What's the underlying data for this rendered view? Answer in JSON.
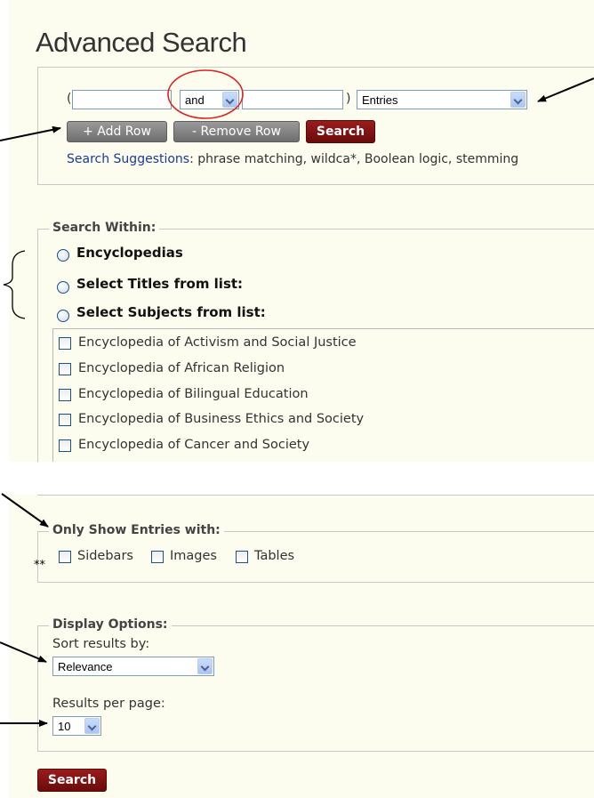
{
  "page": {
    "title": "Advanced Search"
  },
  "query": {
    "open_paren": "(",
    "close_paren": ")",
    "term1_value": "",
    "operator": "and",
    "term2_value": "",
    "field": "Entries"
  },
  "buttons": {
    "add_row": "+ Add Row",
    "remove_row": "- Remove Row",
    "search": "Search",
    "bottom_search": "Search"
  },
  "suggestions": {
    "label": "Search Suggestions",
    "text": ": phrase matching, wildca*, Boolean logic, stemming"
  },
  "search_within": {
    "legend": "Search Within:",
    "options": [
      "Encyclopedias",
      "Select Titles from list:",
      "Select Subjects from list:"
    ],
    "list": [
      "Encyclopedia of Activism and Social Justice",
      "Encyclopedia of African Religion",
      "Encyclopedia of Bilingual Education",
      "Encyclopedia of Business Ethics and Society",
      "Encyclopedia of Cancer and Society"
    ]
  },
  "only_show": {
    "legend": "Only Show Entries with:",
    "marker": "**",
    "options": [
      "Sidebars",
      "Images",
      "Tables"
    ]
  },
  "display": {
    "legend": "Display Options:",
    "sort_label": "Sort results by:",
    "sort_value": "Relevance",
    "per_page_label": "Results per page:",
    "per_page_value": "10"
  },
  "colors": {
    "panel_bg": "#fcfcef",
    "accent_red": "#7a1010",
    "link_blue": "#1a3b9c",
    "annotation_circle": "#e02020"
  }
}
